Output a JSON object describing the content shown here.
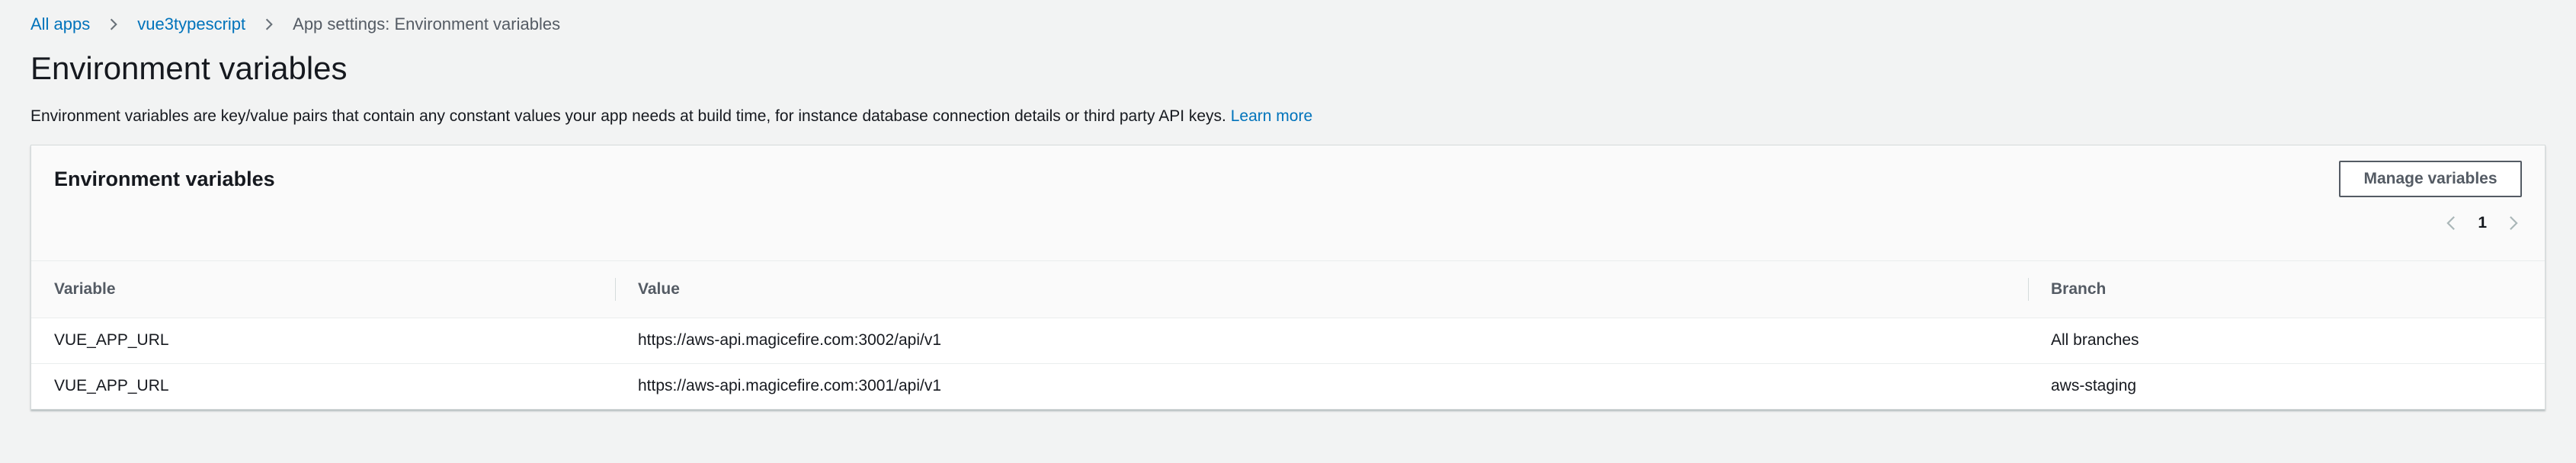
{
  "breadcrumb": {
    "items": [
      {
        "label": "All apps",
        "link": true
      },
      {
        "label": "vue3typescript",
        "link": true
      },
      {
        "label": "App settings: Environment variables",
        "link": false
      }
    ]
  },
  "page": {
    "title": "Environment variables",
    "description": "Environment variables are key/value pairs that contain any constant values your app needs at build time, for instance database connection details or third party API keys.",
    "learn_more": "Learn more"
  },
  "card": {
    "title": "Environment variables",
    "manage_button": "Manage variables",
    "pagination": {
      "current_page": "1"
    }
  },
  "table": {
    "headers": {
      "variable": "Variable",
      "value": "Value",
      "branch": "Branch"
    },
    "rows": [
      {
        "variable": "VUE_APP_URL",
        "value": "https://aws-api.magicefire.com:3002/api/v1",
        "branch": "All branches"
      },
      {
        "variable": "VUE_APP_URL",
        "value": "https://aws-api.magicefire.com:3001/api/v1",
        "branch": "aws-staging"
      }
    ]
  },
  "icons": {
    "breadcrumb_separator": "chevron-right-icon",
    "prev_page": "chevron-left-icon",
    "next_page": "chevron-right-icon"
  },
  "colors": {
    "link": "#0073bb",
    "background": "#f2f3f3",
    "text": "#16191f",
    "muted_text": "#545b64"
  }
}
